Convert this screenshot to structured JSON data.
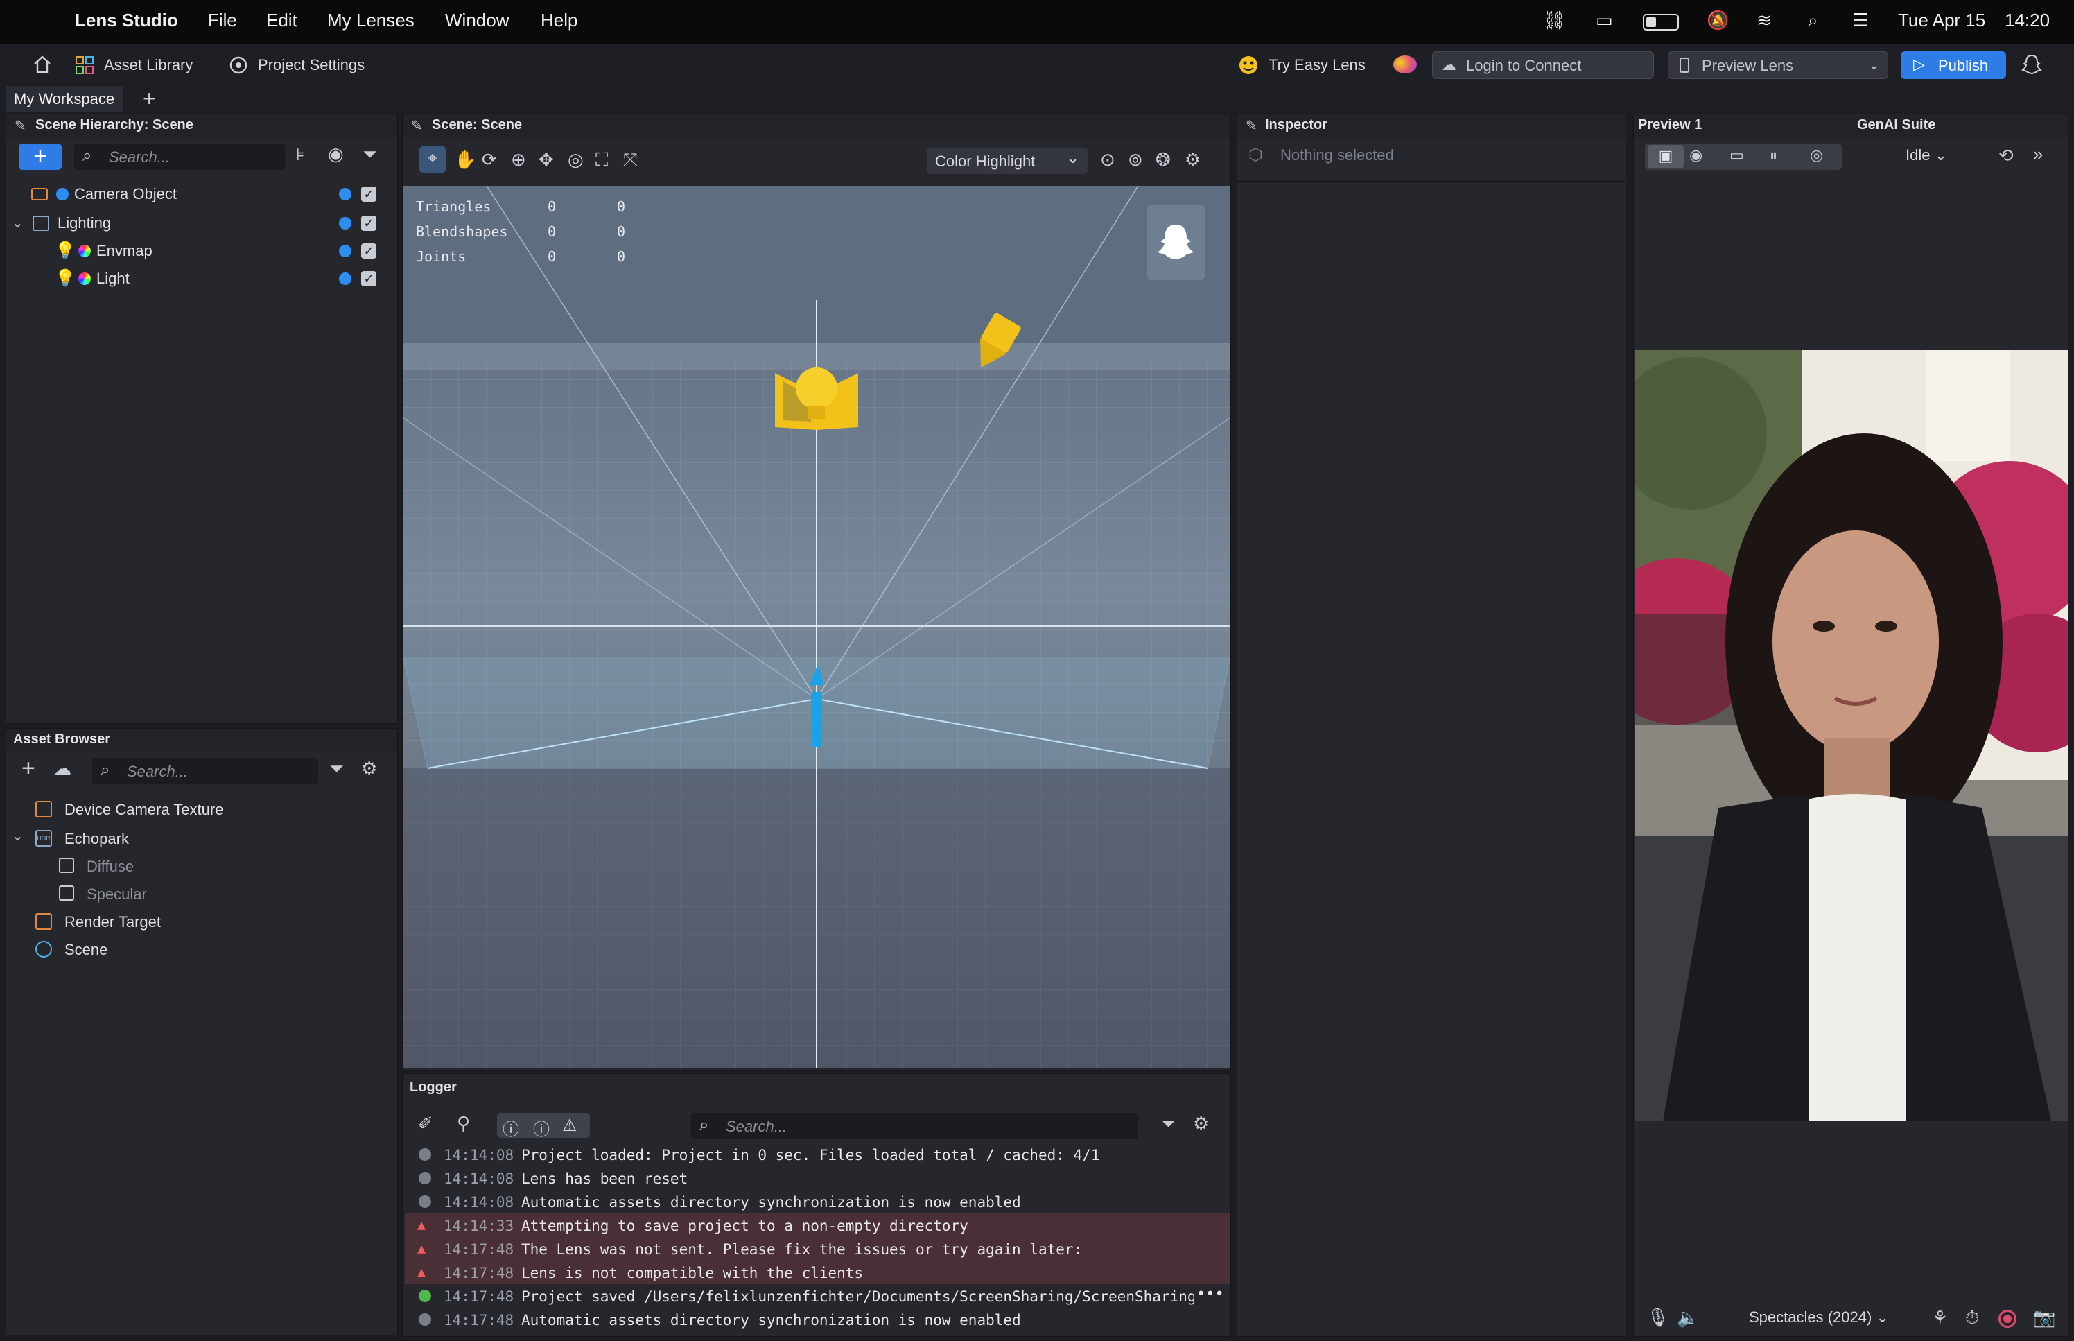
{
  "menubar": {
    "app_name": "Lens Studio",
    "menus": [
      "File",
      "Edit",
      "My Lenses",
      "Window",
      "Help"
    ],
    "date": "Tue Apr 15",
    "time": "14:20"
  },
  "toolbar": {
    "asset_library": "Asset Library",
    "project_settings": "Project Settings",
    "try_easy_lens": "Try Easy Lens",
    "login": "Login to Connect",
    "preview_lens": "Preview Lens",
    "publish": "Publish"
  },
  "workspace": {
    "tab": "My Workspace"
  },
  "scene_hierarchy": {
    "title": "Scene Hierarchy: Scene",
    "search_placeholder": "Search...",
    "items": [
      {
        "label": "Camera Object"
      },
      {
        "label": "Lighting"
      },
      {
        "label": "Envmap"
      },
      {
        "label": "Light"
      }
    ]
  },
  "asset_browser": {
    "title": "Asset Browser",
    "search_placeholder": "Search...",
    "items": [
      {
        "label": "Device Camera Texture"
      },
      {
        "label": "Echopark"
      },
      {
        "label": "Diffuse"
      },
      {
        "label": "Specular"
      },
      {
        "label": "Render Target"
      },
      {
        "label": "Scene"
      }
    ]
  },
  "scene": {
    "title": "Scene: Scene",
    "color_mode": "Color Highlight",
    "stats": [
      {
        "label": "Triangles",
        "a": "0",
        "b": "0"
      },
      {
        "label": "Blendshapes",
        "a": "0",
        "b": "0"
      },
      {
        "label": "Joints",
        "a": "0",
        "b": "0"
      }
    ]
  },
  "inspector": {
    "title": "Inspector",
    "empty_text": "Nothing selected"
  },
  "preview": {
    "tab": "Preview 1",
    "genai_tab": "GenAI Suite",
    "state": "Idle",
    "device": "Spectacles (2024)"
  },
  "logger": {
    "title": "Logger",
    "search_placeholder": "Search...",
    "entries": [
      {
        "time": "14:14:08",
        "msg": "Project loaded: Project in 0 sec. Files loaded total / cached: 4/1",
        "level": "info"
      },
      {
        "time": "14:14:08",
        "msg": "Lens has been reset",
        "level": "info"
      },
      {
        "time": "14:14:08",
        "msg": "Automatic assets directory synchronization is now enabled",
        "level": "info"
      },
      {
        "time": "14:14:33",
        "msg": "Attempting to save project to a non-empty directory",
        "level": "error"
      },
      {
        "time": "14:17:48",
        "msg": "The Lens was not sent. Please fix the issues or try again later:",
        "level": "error"
      },
      {
        "time": "14:17:48",
        "msg": "Lens is not compatible with the clients",
        "level": "error"
      },
      {
        "time": "14:17:48",
        "msg": "Project saved /Users/felixlunzenfichter/Documents/ScreenSharing/ScreenSharing.es",
        "level": "success"
      },
      {
        "time": "14:17:48",
        "msg": "Automatic assets directory synchronization is now enabled",
        "level": "info"
      }
    ]
  },
  "colors": {
    "accent": "#2e7de6",
    "error_row": "#4a2f36",
    "gizmo_yellow": "#f2c21b",
    "camera_blue": "#1aa3e8"
  }
}
